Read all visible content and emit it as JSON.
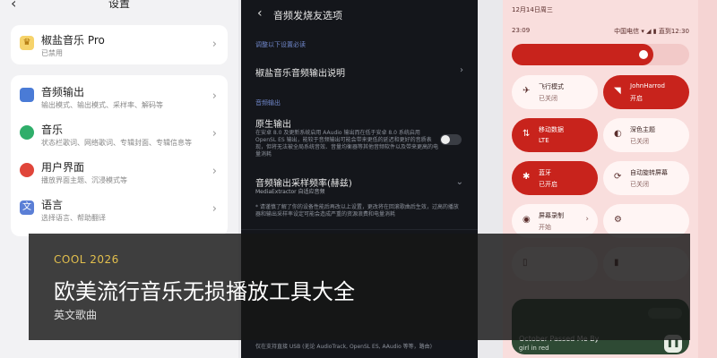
{
  "colors": {
    "accent_red": "#c8231c",
    "overlay_tag": "#e2bf4d",
    "dark_section": "#6f86c9"
  },
  "panel1": {
    "title": "设置",
    "pro": {
      "title": "椒盐音乐 Pro",
      "subtitle": "已禁用"
    },
    "items": [
      {
        "icon": "headphones-icon",
        "color": "#4a7bd6",
        "title": "音频输出",
        "subtitle": "输出模式、输出模式、采样率、解码等"
      },
      {
        "icon": "music-note-icon",
        "color": "#2fae6a",
        "title": "音乐",
        "subtitle": "状态栏歌词、网络歌词、专辑封面、专辑信息等"
      },
      {
        "icon": "palette-icon",
        "color": "#e0453a",
        "title": "用户界面",
        "subtitle": "播放界面主题、沉浸模式等"
      },
      {
        "icon": "translate-icon",
        "color": "#5b7fd6",
        "title": "语言",
        "subtitle": "选择语言、帮助翻译"
      }
    ]
  },
  "panel2": {
    "title": "音频发烧友选项",
    "section1": "调整以下设置必读",
    "link": "椒盐音乐音频输出说明",
    "section2": "音频输出",
    "raw_title": "原生输出",
    "raw_desc": "在安卓 8.0 及更新系统启用 AAudio 输出而在低于安卓 8.0 系统启用 OpenSL ES 输出，能较于音频输出可能会带来更低的延迟和更好的音质表现，但将无法被全局系统音效、音量均衡器等其他音频软件以及带来更高的电量消耗",
    "rate_title": "音频输出采样频率(赫兹)",
    "rate_value": "MediaExtractor 自适应音频",
    "rate_note": "* 请谨慎了解了你的设备性能后再改以上设置，更改将在回滚歌曲后生效，过高的播放器和输出采样率设定可能会造成严重的资源浪费和电量消耗",
    "bottom_text": "仅在支持直接 USB (无论 AudioTrack, OpenSL ES, AAudio 等等，路由)"
  },
  "panel3": {
    "date": "12月14日周三",
    "time": "23:09",
    "status": "中国电信 ▾ ◢ ▮ 直到12:30",
    "brightness_level": 0.8,
    "tiles": [
      {
        "icon": "airplane-icon",
        "glyph": "✈",
        "title": "飞行模式",
        "sub": "已关闭",
        "on": false
      },
      {
        "icon": "wifi-icon",
        "glyph": "◥",
        "title": "JohnHarrod",
        "sub": "开启",
        "on": true
      },
      {
        "icon": "swap-icon",
        "glyph": "⇅",
        "title": "移动数据",
        "sub": "LTE",
        "on": true
      },
      {
        "icon": "theme-icon",
        "glyph": "◐",
        "title": "深色主题",
        "sub": "已关闭",
        "on": false
      },
      {
        "icon": "bluetooth-icon",
        "glyph": "✱",
        "title": "蓝牙",
        "sub": "已开启",
        "on": true
      },
      {
        "icon": "rotate-icon",
        "glyph": "⟳",
        "title": "自动旋转屏幕",
        "sub": "已关闭",
        "on": false
      },
      {
        "icon": "record-icon",
        "glyph": "◉",
        "title": "屏幕录制",
        "sub": "开始",
        "on": false
      },
      {
        "icon": "settings-icon",
        "glyph": "⚙",
        "title": "",
        "sub": "",
        "on": false
      },
      {
        "icon": "flashlight-icon",
        "glyph": "▯",
        "title": "",
        "sub": "",
        "on": false
      },
      {
        "icon": "battery-icon",
        "glyph": "▮",
        "title": "",
        "sub": "",
        "on": false
      }
    ],
    "media": {
      "song": "October Passed Me By",
      "artist": "girl in red"
    }
  },
  "overlay": {
    "tag": "COOL 2026",
    "title": "欧美流行音乐无损播放工具大全",
    "subtitle": "英文歌曲"
  }
}
